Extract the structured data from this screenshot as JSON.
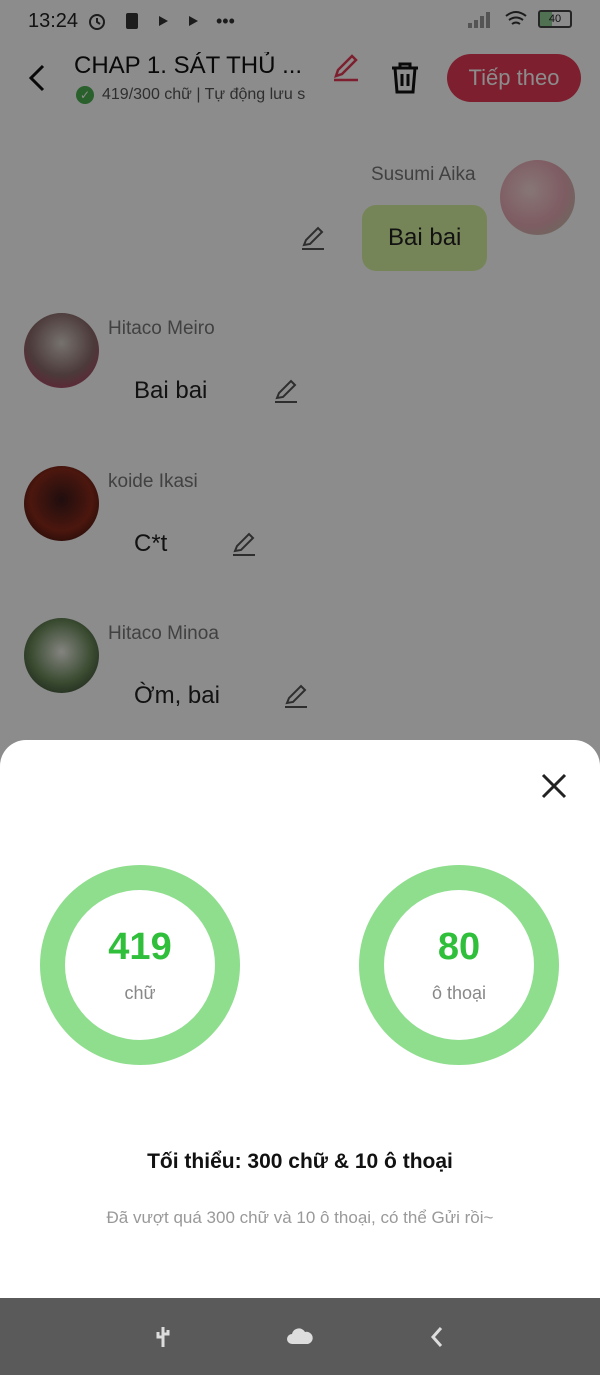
{
  "status": {
    "time": "13:24",
    "battery": "40"
  },
  "header": {
    "title": "CHAP 1. SÁT THỦ ...",
    "subtitle": "419/300 chữ | Tự động lưu s",
    "next_label": "Tiếp theo"
  },
  "chat": {
    "messages": [
      {
        "sender": "Susumi Aika",
        "text": "Bai bai"
      },
      {
        "sender": "Hitaco Meiro",
        "text": "Bai bai"
      },
      {
        "sender": "koide Ikasi",
        "text": "C*t"
      },
      {
        "sender": "Hitaco Minoa",
        "text": "Ờm, bai"
      }
    ]
  },
  "sheet": {
    "words_value": "419",
    "words_label": "chữ",
    "dialogs_value": "80",
    "dialogs_label": "ô thoại",
    "minimum_text": "Tối thiểu: 300 chữ & 10 ô thoại",
    "hint_text": "Đã vượt quá 300 chữ và 10 ô thoại, có thể Gửi rồi~"
  },
  "colors": {
    "accent": "#e33a55",
    "ring": "#8ede8e",
    "ring_text": "#2fbf3a",
    "bubble_self": "#d7f3a0"
  }
}
